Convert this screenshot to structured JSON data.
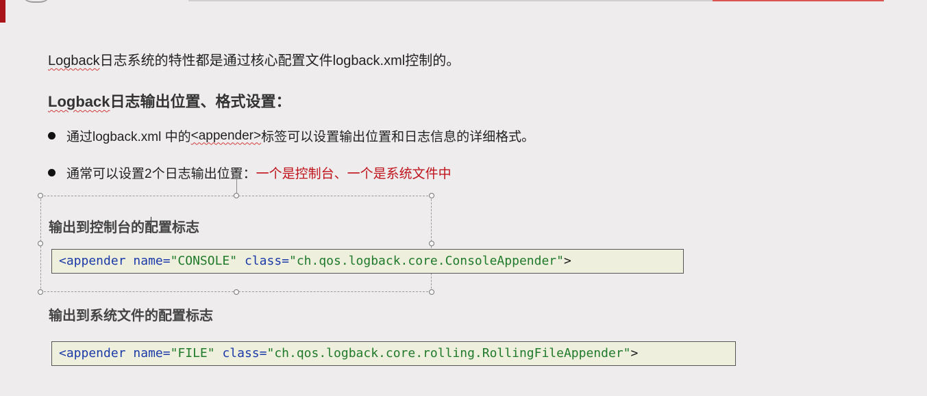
{
  "intro": {
    "brand": "Logback",
    "text": "日志系统的特性都是通过核心配置文件logback.xml控制的。"
  },
  "heading": {
    "brand": "Logback",
    "text": "日志输出位置、格式设置："
  },
  "bullets": [
    {
      "prefix": "通过logback.xml 中的",
      "tag": "<appender>",
      "suffix": "标签可以设置输出位置和日志信息的详细格式。"
    },
    {
      "prefix": "通常可以设置2个日志输出位置：",
      "highlight": "一个是控制台、一个是系统文件中"
    }
  ],
  "console_section": {
    "title": "输出到控制台的配置标志",
    "code": {
      "open": "<appender",
      "attr1": "name=",
      "val1": "\"CONSOLE\"",
      "attr2": "class=",
      "val2": "\"ch.qos.logback.core.ConsoleAppender\"",
      "close": ">"
    }
  },
  "file_section": {
    "title": "输出到系统文件的配置标志",
    "code": {
      "open": "<appender",
      "attr1": "name=",
      "val1": "\"FILE\"",
      "attr2": "class=",
      "val2": "\"ch.qos.logback.core.rolling.RollingFileAppender\"",
      "close": ">"
    }
  },
  "colors": {
    "accent_red": "#c0121b",
    "code_tag": "#1b3aa8",
    "code_value": "#1f7a2a",
    "code_bg": "#efefde"
  }
}
